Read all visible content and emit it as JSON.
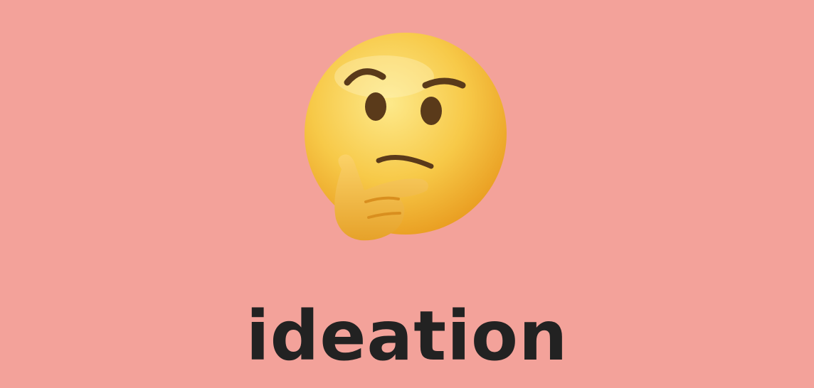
{
  "page": {
    "background_color": "#f3a29a",
    "title": "ideation",
    "title_color": "#222222"
  },
  "emoji": {
    "icon": "thinking-face-icon",
    "face_color": "#f7c948",
    "hand_color": "#f4b63a",
    "feature_color": "#5a3a1a"
  }
}
